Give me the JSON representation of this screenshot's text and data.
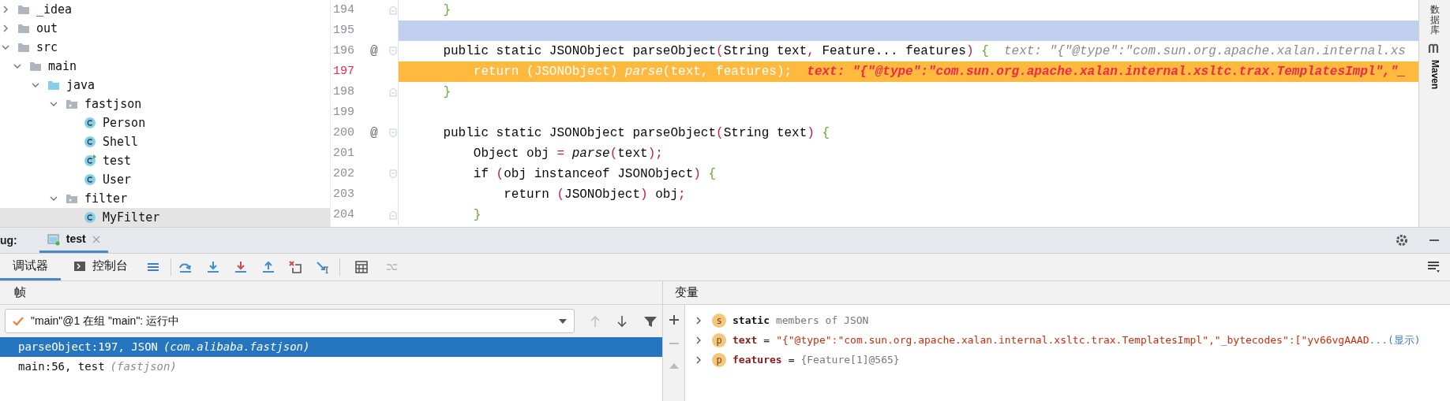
{
  "project_tree": [
    {
      "label": "_idea",
      "kind": "folder",
      "expanded": false,
      "selected": false
    },
    {
      "label": "out",
      "kind": "folder",
      "expanded": false,
      "selected": false
    },
    {
      "label": "src",
      "kind": "folder",
      "expanded": true,
      "selected": false,
      "children": [
        {
          "label": "main",
          "kind": "folder",
          "expanded": true,
          "selected": false,
          "children": [
            {
              "label": "java",
              "kind": "source-folder",
              "expanded": true,
              "selected": false,
              "children": [
                {
                  "label": "fastjson",
                  "kind": "package",
                  "expanded": true,
                  "selected": false,
                  "children": [
                    {
                      "label": "Person",
                      "kind": "class",
                      "selected": false
                    },
                    {
                      "label": "Shell",
                      "kind": "class",
                      "selected": false
                    },
                    {
                      "label": "test",
                      "kind": "runnable-class",
                      "selected": false
                    },
                    {
                      "label": "User",
                      "kind": "class",
                      "selected": false
                    }
                  ]
                },
                {
                  "label": "filter",
                  "kind": "package",
                  "expanded": true,
                  "selected": false,
                  "children": [
                    {
                      "label": "MyFilter",
                      "kind": "class",
                      "selected": true
                    }
                  ]
                }
              ]
            }
          ]
        }
      ]
    }
  ],
  "editor": {
    "lines": [
      {
        "number": "194",
        "current": false,
        "execution": false,
        "fold_start": false,
        "fold_end": true,
        "segments": [
          {
            "kind": "brace",
            "text": "    }"
          }
        ]
      },
      {
        "number": "195",
        "current": true,
        "execution": false,
        "fold_start": false,
        "fold_end": false
      },
      {
        "number": "196",
        "current": false,
        "execution": false,
        "gutter_mark": "@",
        "fold_start": true,
        "fold_end": false,
        "segments": [
          {
            "kind": "code",
            "text": "    public static JSONObject parseObject"
          },
          {
            "kind": "paren",
            "text": "("
          },
          {
            "kind": "code",
            "text": "String text"
          },
          {
            "kind": "paren",
            "text": ","
          },
          {
            "kind": "code",
            "text": " Feature... features"
          },
          {
            "kind": "paren",
            "text": ")"
          },
          {
            "kind": "brace",
            "text": " {"
          },
          {
            "kind": "hint",
            "text": "  text: \"{\"@type\":\"com.sun.org.apache.xalan.internal.xs"
          }
        ]
      },
      {
        "number": "197",
        "current": false,
        "execution": true,
        "fold_start": false,
        "fold_end": false,
        "segments": [
          {
            "kind": "code",
            "text": "        return (JSONObject) "
          },
          {
            "kind": "call",
            "text": "parse"
          },
          {
            "kind": "code",
            "text": "(text, features);"
          },
          {
            "kind": "hint-active",
            "text": "  text: \"{\"@type\":\"com.sun.org.apache.xalan.internal.xsltc.trax.TemplatesImpl\",\"_"
          }
        ]
      },
      {
        "number": "198",
        "current": false,
        "execution": false,
        "fold_start": false,
        "fold_end": true,
        "segments": [
          {
            "kind": "brace",
            "text": "    }"
          }
        ]
      },
      {
        "number": "199",
        "current": false,
        "execution": false,
        "fold_start": false,
        "fold_end": false
      },
      {
        "number": "200",
        "current": false,
        "execution": false,
        "gutter_mark": "@",
        "fold_start": true,
        "fold_end": false,
        "segments": [
          {
            "kind": "code",
            "text": "    public static JSONObject parseObject"
          },
          {
            "kind": "paren",
            "text": "("
          },
          {
            "kind": "code",
            "text": "String text"
          },
          {
            "kind": "paren",
            "text": ")"
          },
          {
            "kind": "brace",
            "text": " {"
          }
        ]
      },
      {
        "number": "201",
        "current": false,
        "execution": false,
        "fold_start": false,
        "fold_end": false,
        "segments": [
          {
            "kind": "code",
            "text": "        Object obj"
          },
          {
            "kind": "paren",
            "text": " ="
          },
          {
            "kind": "call",
            "text": " parse"
          },
          {
            "kind": "paren",
            "text": "("
          },
          {
            "kind": "code",
            "text": "text"
          },
          {
            "kind": "paren",
            "text": ");"
          }
        ]
      },
      {
        "number": "202",
        "current": false,
        "execution": false,
        "fold_start": true,
        "fold_end": false,
        "segments": [
          {
            "kind": "code",
            "text": "        if"
          },
          {
            "kind": "paren",
            "text": " ("
          },
          {
            "kind": "code",
            "text": "obj instanceof JSONObject"
          },
          {
            "kind": "paren",
            "text": ")"
          },
          {
            "kind": "brace",
            "text": " {"
          }
        ]
      },
      {
        "number": "203",
        "current": false,
        "execution": false,
        "fold_start": false,
        "fold_end": false,
        "segments": [
          {
            "kind": "code",
            "text": "            return"
          },
          {
            "kind": "paren",
            "text": " ("
          },
          {
            "kind": "code",
            "text": "JSONObject"
          },
          {
            "kind": "paren",
            "text": ")"
          },
          {
            "kind": "code",
            "text": " obj"
          },
          {
            "kind": "paren",
            "text": ";"
          }
        ]
      },
      {
        "number": "204",
        "current": false,
        "execution": false,
        "fold_start": false,
        "fold_end": true,
        "segments": [
          {
            "kind": "brace",
            "text": "        }"
          }
        ]
      }
    ]
  },
  "right_strip": {
    "database": "数据库",
    "maven": "Maven"
  },
  "debug": {
    "label": "ug:",
    "tabs": [
      {
        "label": "test",
        "selected": true
      }
    ],
    "sub_tabs": [
      {
        "label": "调试器",
        "selected": true,
        "kind": "plain"
      },
      {
        "label": "控制台",
        "selected": false,
        "kind": "console"
      }
    ],
    "frames": {
      "title": "帧",
      "thread": "\"main\"@1 在组 \"main\": 运行中",
      "rows": [
        {
          "method": "parseObject:197, JSON",
          "package": "(com.alibaba.fastjson)",
          "selected": true
        },
        {
          "method": "main:56, test",
          "package": "(fastjson)",
          "selected": false
        }
      ]
    },
    "variables": {
      "title": "变量",
      "rows": [
        {
          "badge": "s",
          "name": "static",
          "segments": [
            {
              "kind": "comment",
              "text": "members of JSON"
            }
          ]
        },
        {
          "badge": "p",
          "name": "text",
          "segments": [
            {
              "kind": "operator",
              "text": "="
            },
            {
              "kind": "string",
              "text": "\"{\"@type\":\"com.sun.org.apache.xalan.internal.xsltc.trax.TemplatesImpl\",\"_bytecodes\":[\"yv66vgAAAD"
            },
            {
              "kind": "link",
              "text": "...(显示)"
            }
          ]
        },
        {
          "badge": "p",
          "name": "features",
          "segments": [
            {
              "kind": "operator",
              "text": "="
            },
            {
              "kind": "comment",
              "text": "{Feature[1]@565}"
            }
          ]
        }
      ]
    }
  }
}
